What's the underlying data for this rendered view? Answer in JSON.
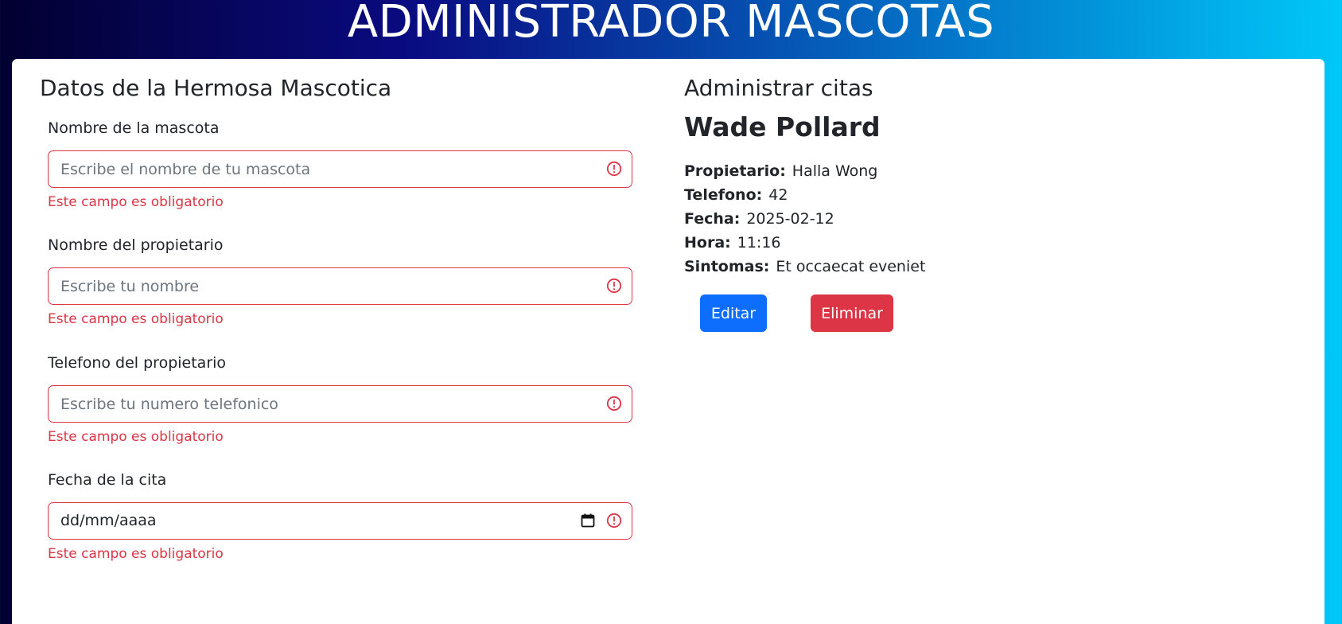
{
  "header": {
    "title": "ADMINISTRADOR MASCOTAS"
  },
  "form": {
    "title": "Datos de la Hermosa Mascotica",
    "fields": [
      {
        "label": "Nombre de la mascota",
        "placeholder": "Escribe el nombre de tu mascota",
        "value": "",
        "error": "Este campo es obligatorio",
        "icon": "warning-circle-icon"
      },
      {
        "label": "Nombre del propietario",
        "placeholder": "Escribe tu nombre",
        "value": "",
        "error": "Este campo es obligatorio",
        "icon": "warning-circle-icon"
      },
      {
        "label": "Telefono del propietario",
        "placeholder": "Escribe tu numero telefonico",
        "value": "",
        "error": "Este campo es obligatorio",
        "icon": "warning-circle-icon"
      },
      {
        "label": "Fecha de la cita",
        "placeholder": "dd/mm/aaaa",
        "value": "",
        "error": "Este campo es obligatorio",
        "icon": "calendar-icon"
      }
    ]
  },
  "appointments": {
    "title": "Administrar citas",
    "pet_name": "Wade Pollard",
    "details": [
      {
        "key": "Propietario:",
        "value": "Halla Wong"
      },
      {
        "key": "Telefono:",
        "value": "42"
      },
      {
        "key": "Fecha:",
        "value": "2025-02-12"
      },
      {
        "key": "Hora:",
        "value": "11:16"
      },
      {
        "key": "Sintomas:",
        "value": "Et occaecat eveniet"
      }
    ],
    "edit_label": "Editar",
    "delete_label": "Eliminar"
  },
  "colors": {
    "error": "#dc3545",
    "primary": "#0d6efd",
    "danger": "#dc3545"
  }
}
